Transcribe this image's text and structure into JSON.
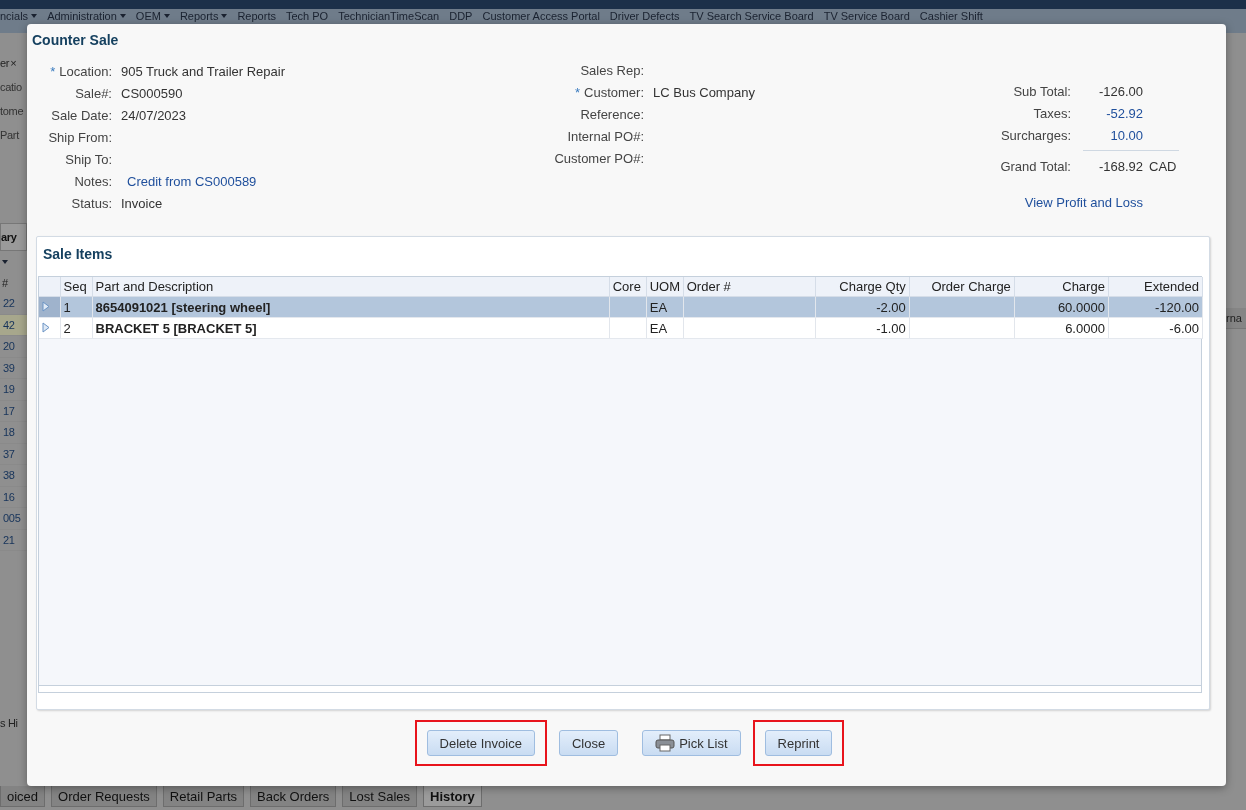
{
  "menu_bar": {
    "items": [
      {
        "label": "ncials",
        "dropdown": true
      },
      {
        "label": "Administration",
        "dropdown": true
      },
      {
        "label": "OEM",
        "dropdown": true
      },
      {
        "label": "Reports",
        "dropdown": true
      },
      {
        "label": "Reports",
        "dropdown": false
      },
      {
        "label": "Tech PO",
        "dropdown": false
      },
      {
        "label": "TechnicianTimeScan",
        "dropdown": false
      },
      {
        "label": "DDP",
        "dropdown": false
      },
      {
        "label": "Customer Access Portal",
        "dropdown": false
      },
      {
        "label": "Driver Defects",
        "dropdown": false
      },
      {
        "label": "TV Search Service Board",
        "dropdown": false
      },
      {
        "label": "TV Service Board",
        "dropdown": false
      },
      {
        "label": "Cashier Shift",
        "dropdown": false
      }
    ]
  },
  "page_left": {
    "tab": "er",
    "tab_close": "×",
    "fields": [
      "catio",
      "tome",
      "Part"
    ],
    "panel_tab": "ary",
    "grid_header": "#",
    "rows": [
      {
        "text": "22",
        "selected": false
      },
      {
        "text": "42",
        "selected": true
      },
      {
        "text": "20",
        "selected": false
      },
      {
        "text": "39",
        "selected": false
      },
      {
        "text": "19",
        "selected": false
      },
      {
        "text": "17",
        "selected": false
      },
      {
        "text": "18",
        "selected": false
      },
      {
        "text": "37",
        "selected": false
      },
      {
        "text": "38",
        "selected": false
      },
      {
        "text": "16",
        "selected": false
      },
      {
        "text": "005",
        "selected": false
      },
      {
        "text": "21",
        "selected": false
      }
    ],
    "footer": "s Hi"
  },
  "page_right": {
    "column_header": "rna"
  },
  "bottom_tabs": [
    {
      "label": "oiced",
      "selected": false
    },
    {
      "label": "Order Requests",
      "selected": false
    },
    {
      "label": "Retail Parts",
      "selected": false
    },
    {
      "label": "Back Orders",
      "selected": false
    },
    {
      "label": "Lost Sales",
      "selected": false
    },
    {
      "label": "History",
      "selected": true
    }
  ],
  "dialog": {
    "title": "Counter Sale",
    "fields_left": [
      {
        "marker": "*",
        "label": "Location:",
        "value": "905 Truck and Trailer Repair",
        "kind": "text"
      },
      {
        "label": "Sale#:",
        "value": "CS000590",
        "kind": "text"
      },
      {
        "label": "Sale Date:",
        "value": "24/07/2023",
        "kind": "text"
      },
      {
        "label": "Ship From:"
      },
      {
        "label": "Ship To:"
      },
      {
        "label": "Notes:",
        "value": "Credit from CS000589",
        "kind": "link"
      },
      {
        "label": "Status:",
        "value": "Invoice",
        "kind": "text"
      }
    ],
    "fields_middle": [
      {
        "label": "Sales Rep:"
      },
      {
        "marker": "*",
        "label": "Customer:",
        "value": "LC Bus Company",
        "kind": "text"
      },
      {
        "label": "Reference:"
      },
      {
        "label": "Internal PO#:"
      },
      {
        "label": "Customer PO#:"
      }
    ],
    "totals": [
      {
        "label": "Sub Total:",
        "value": "-126.00",
        "link": false
      },
      {
        "label": "Taxes:",
        "value": "-52.92",
        "link": true
      },
      {
        "label": "Surcharges:",
        "value": "10.00",
        "link": true
      }
    ],
    "grand_total": {
      "label": "Grand Total:",
      "value": "-168.92",
      "currency": "CAD"
    },
    "profit_link": "View Profit and Loss",
    "sale_items": {
      "title": "Sale Items",
      "columns": [
        {
          "label": "Seq",
          "kind": "text"
        },
        {
          "label": "Part and Description",
          "kind": "text"
        },
        {
          "label": "Core",
          "kind": "text"
        },
        {
          "label": "UOM",
          "kind": "text"
        },
        {
          "label": "Order #",
          "kind": "text"
        },
        {
          "label": "Charge Qty",
          "kind": "number"
        },
        {
          "label": "Order Charge",
          "kind": "number"
        },
        {
          "label": "Charge",
          "kind": "number"
        },
        {
          "label": "Extended",
          "kind": "number"
        }
      ],
      "rows": [
        {
          "selected": true,
          "cells": [
            "1",
            "8654091021 [steering wheel]",
            "",
            "EA",
            "",
            "-2.00",
            "",
            "60.0000",
            "-120.00"
          ]
        },
        {
          "selected": false,
          "cells": [
            "2",
            "BRACKET 5 [BRACKET 5]",
            "",
            "EA",
            "",
            "-1.00",
            "",
            "6.0000",
            "-6.00"
          ]
        }
      ]
    },
    "buttons": [
      {
        "label": "Delete Invoice",
        "kind": "plain",
        "highlighted": true
      },
      {
        "label": "Close",
        "kind": "plain",
        "highlighted": false
      },
      {
        "label": "Pick List",
        "kind": "print",
        "highlighted": false
      },
      {
        "label": "Reprint",
        "kind": "plain",
        "highlighted": true
      }
    ]
  }
}
